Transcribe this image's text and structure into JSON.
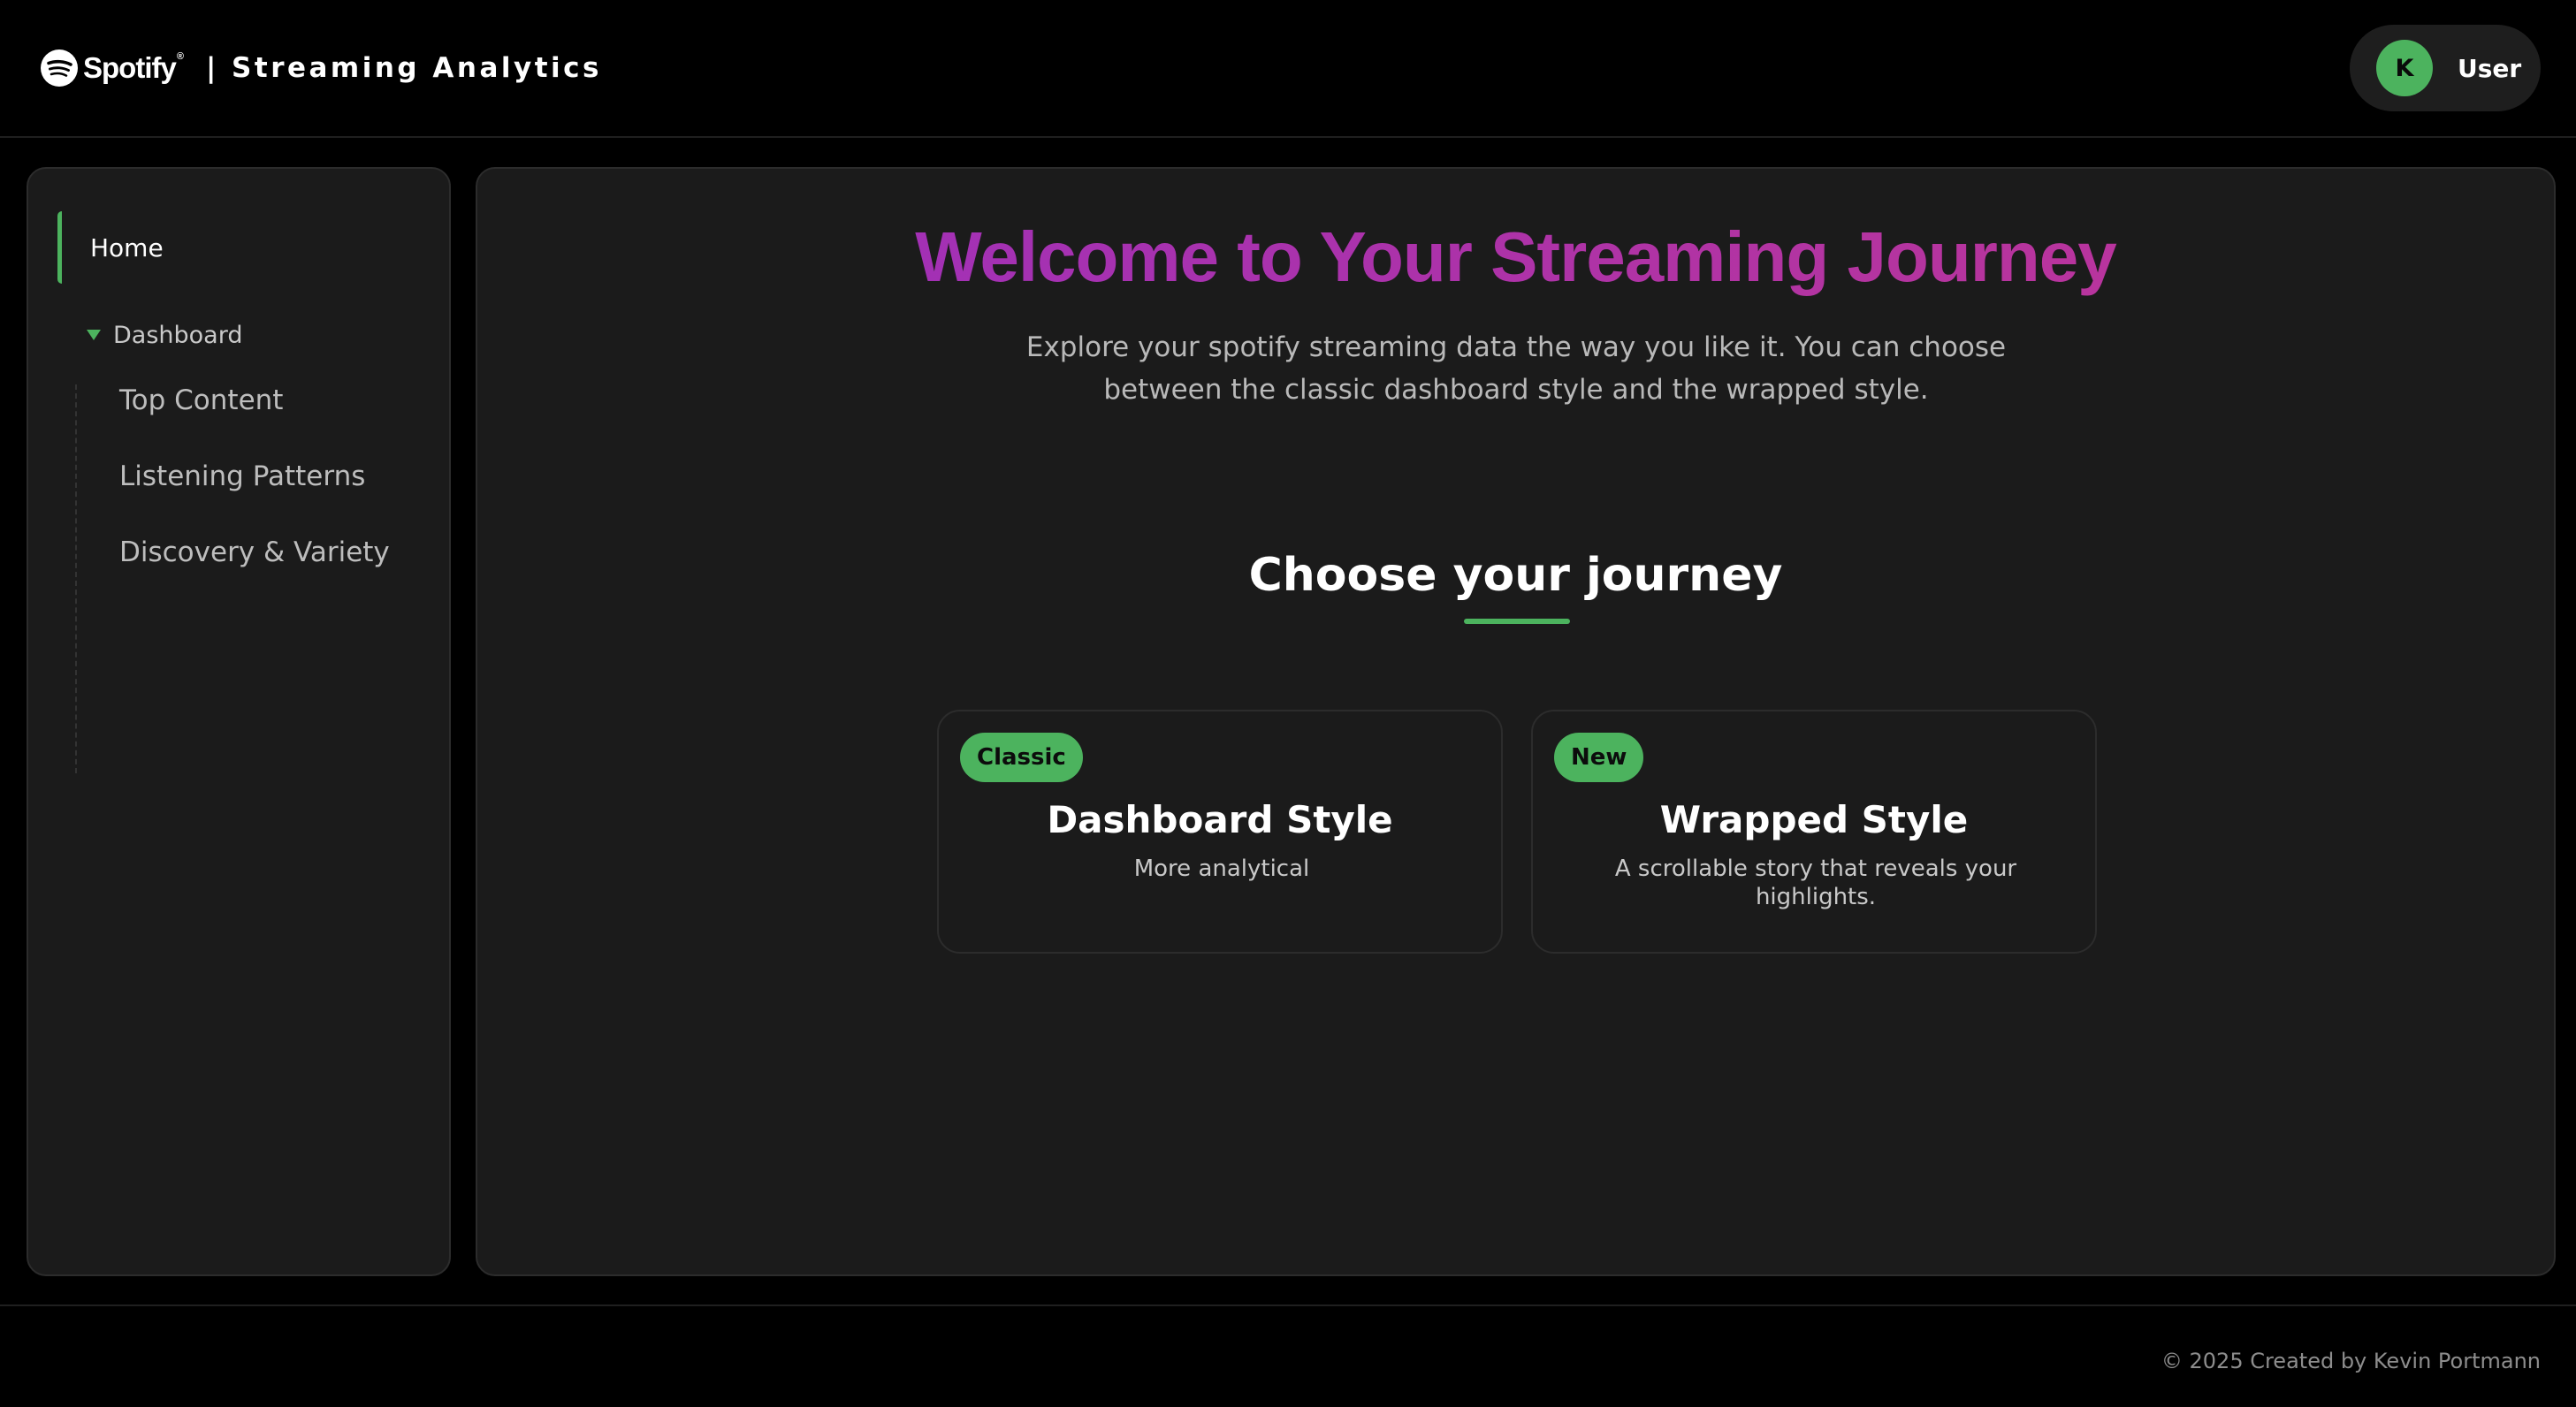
{
  "header": {
    "logo_text": "Spotify",
    "logo_tm": "®",
    "title": "| Streaming Analytics",
    "user": {
      "avatar_initial": "K",
      "name": "User"
    }
  },
  "sidebar": {
    "home": "Home",
    "dashboard": "Dashboard",
    "sub_items": [
      {
        "label": "Top Content"
      },
      {
        "label": "Listening Patterns"
      },
      {
        "label": "Discovery & Variety"
      }
    ]
  },
  "main": {
    "title": "Welcome to Your Streaming Journey",
    "subtitle": "Explore your spotify streaming data the way you like it. You can choose between the classic dashboard style and the wrapped style.",
    "choose_title": "Choose your journey",
    "cards": [
      {
        "badge": "Classic",
        "title": "Dashboard Style",
        "description": "More analytical"
      },
      {
        "badge": "New",
        "title": "Wrapped Style",
        "description": "A scrollable story that reveals your highlights."
      }
    ]
  },
  "footer": {
    "text": "© 2025 Created by Kevin Portmann"
  },
  "colors": {
    "accent_green": "#4cb35e",
    "title_gradient_start": "#9b2fbe",
    "title_gradient_end": "#c2359a",
    "panel_bg": "#1b1b1b",
    "page_bg": "#000000"
  },
  "icons": [
    "spotify-logo-icon",
    "caret-down-icon"
  ]
}
